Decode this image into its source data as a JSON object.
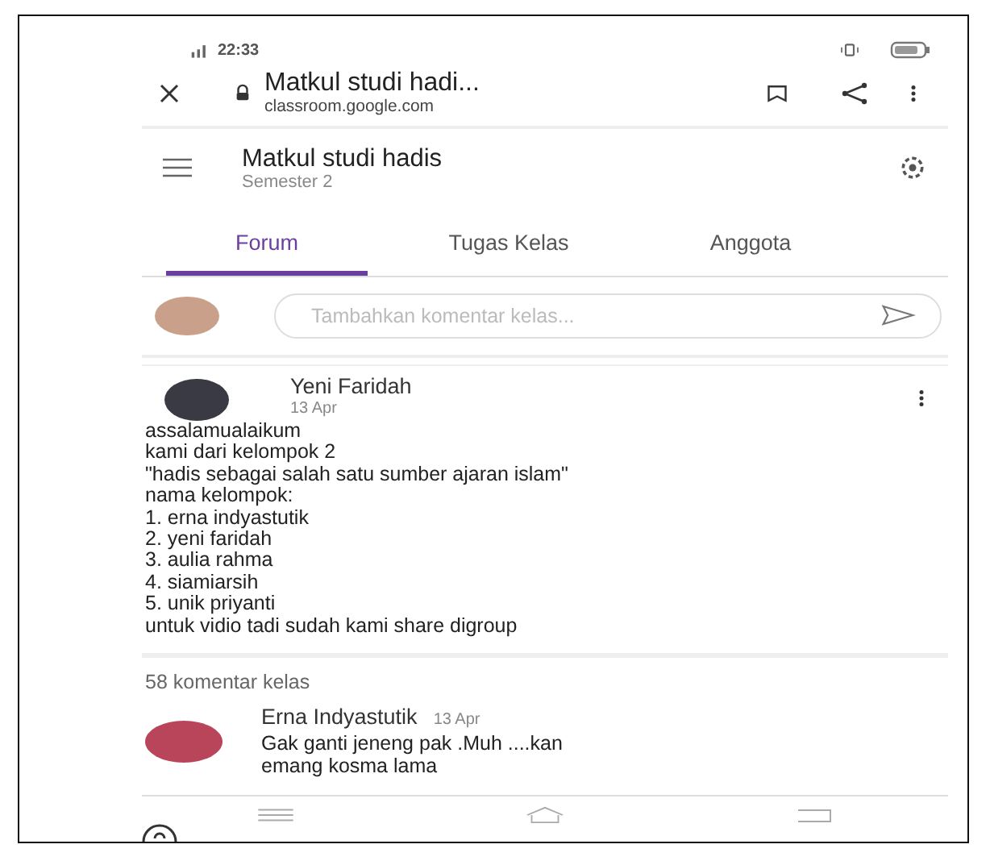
{
  "status_bar": {
    "time": "22:33"
  },
  "browser_bar": {
    "title": "Matkul studi hadi...",
    "url": "classroom.google.com"
  },
  "class_header": {
    "title": "Matkul studi hadis",
    "subtitle": "Semester 2"
  },
  "tabs": [
    {
      "label": "Forum",
      "selected": true
    },
    {
      "label": "Tugas Kelas",
      "selected": false
    },
    {
      "label": "Anggota",
      "selected": false
    }
  ],
  "comment_field": {
    "placeholder": "Tambahkan komentar kelas..."
  },
  "post": {
    "author": "Yeni Faridah",
    "date": "13 Apr",
    "lines": [
      "assalamualaikum",
      "kami dari kelompok 2",
      "\"hadis sebagai salah satu sumber ajaran islam\"",
      "nama kelompok:",
      "1. erna indyastutik",
      "2. yeni faridah",
      "3. aulia rahma",
      "4. siamiarsih",
      "5. unik priyanti",
      "untuk vidio tadi sudah kami share digroup"
    ]
  },
  "comments_count": "58 komentar kelas",
  "comments": [
    {
      "author": "Erna Indyastutik",
      "date": "13 Apr",
      "lines": [
        "Gak ganti jeneng pak .Muh ....kan",
        "emang kosma lama"
      ]
    }
  ]
}
